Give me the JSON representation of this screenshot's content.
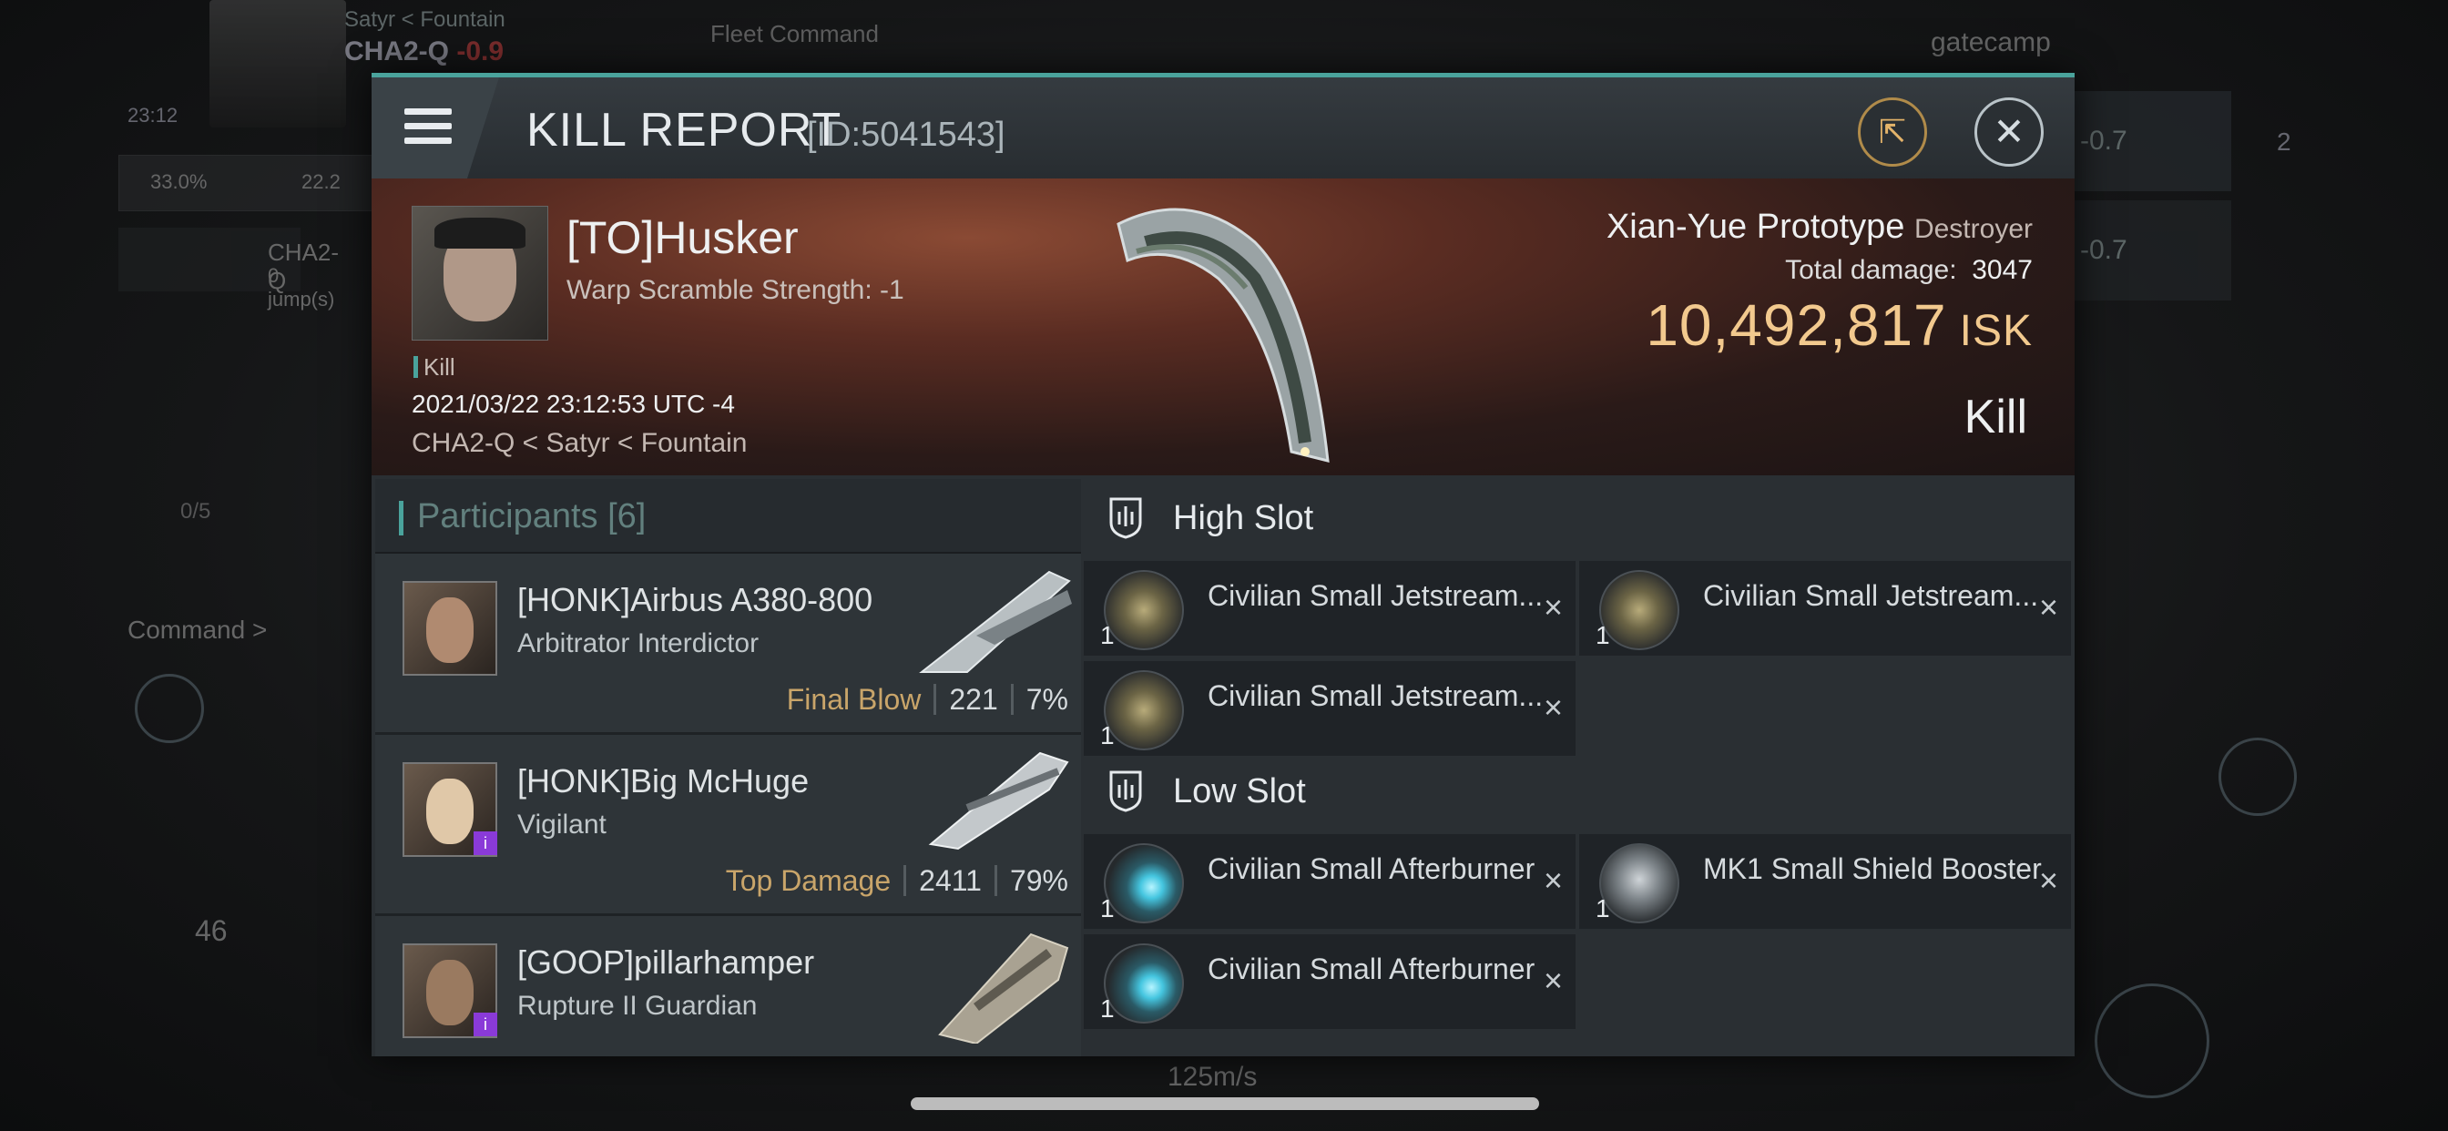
{
  "background": {
    "pilot_location": "Satyr < Fountain",
    "system": "CHA2-Q",
    "security": "-0.9",
    "clock": "23:12",
    "fleet_command": "Fleet Command",
    "filter": "gatecamp",
    "stat_1": "33.0%",
    "stat_2": "22.2",
    "nav_system": "CHA2-Q",
    "nav_jumps": "0 jump(s)",
    "command_label": "Command >",
    "slots": "0/5",
    "local_count": "46",
    "overview_1": "-0.7",
    "overview_2": "-0.7",
    "badge": "2",
    "speed": "125m/s"
  },
  "dialog": {
    "title": "KILL REPORT",
    "id": "[ID:5041543]",
    "share_icon": "share-icon",
    "close_icon": "close-icon"
  },
  "victim": {
    "name": "[TO]Husker",
    "attribute": "Warp Scramble Strength: -1",
    "tag": "Kill",
    "datetime": "2021/03/22 23:12:53 UTC -4",
    "location": "CHA2-Q < Satyr < Fountain",
    "ship": "Xian-Yue Prototype",
    "ship_class": "Destroyer",
    "total_damage_label": "Total damage:",
    "total_damage": "3047",
    "isk_value": "10,492,817",
    "isk_unit": "ISK",
    "result": "Kill"
  },
  "participants": {
    "title": "Participants",
    "count": "[6]",
    "rows": [
      {
        "name": "[HONK]Airbus A380-800",
        "ship": "Arbitrator Interdictor",
        "label": "Final Blow",
        "damage": "221",
        "percent": "7%"
      },
      {
        "name": "[HONK]Big McHuge",
        "ship": "Vigilant",
        "label": "Top Damage",
        "damage": "2411",
        "percent": "79%"
      },
      {
        "name": "[GOOP]pillarhamper",
        "ship": "Rupture II Guardian",
        "label": "",
        "damage": "",
        "percent": ""
      }
    ]
  },
  "fittings": {
    "high_slot": "High Slot",
    "low_slot": "Low Slot",
    "high_items": [
      {
        "name": "Civilian Small Jetstream...",
        "qty": "1"
      },
      {
        "name": "Civilian Small Jetstream...",
        "qty": "1"
      },
      {
        "name": "Civilian Small Jetstream...",
        "qty": "1"
      }
    ],
    "low_items": [
      {
        "name": "Civilian Small Afterburner",
        "qty": "1"
      },
      {
        "name": "MK1 Small Shield Booster",
        "qty": "1"
      },
      {
        "name": "Civilian Small Afterburner",
        "qty": "1"
      }
    ],
    "remove_glyph": "×"
  },
  "colors": {
    "accent": "#4aa39c",
    "isk": "#f2c98e",
    "stat_label": "#c9a56a",
    "security": "#d04040"
  }
}
